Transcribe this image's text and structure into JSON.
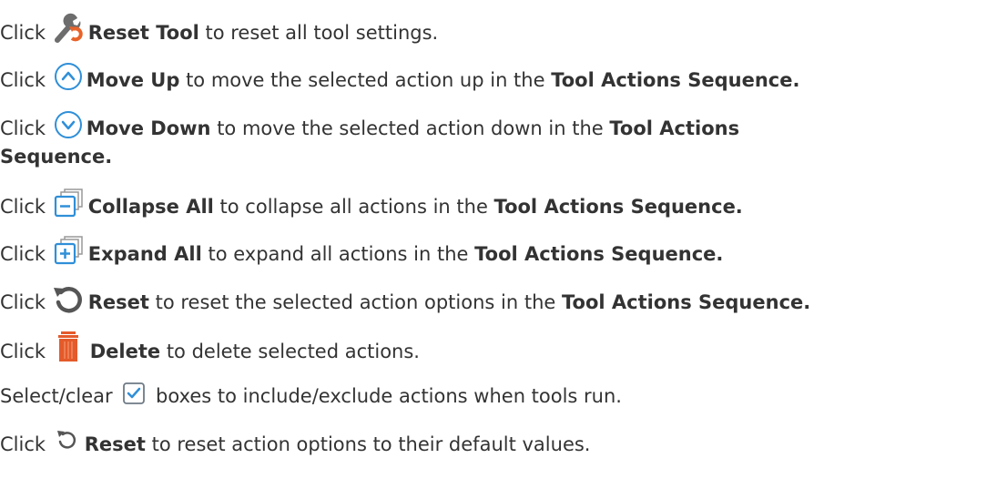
{
  "colors": {
    "text": "#333333",
    "icon_blue": "#2f8fd8",
    "icon_orange": "#e8632a",
    "trash_orange": "#e45a2a",
    "icon_gray": "#555555"
  },
  "lines": [
    {
      "pre": "Click",
      "icon": "wrench-reset-icon",
      "bold": "Reset Tool",
      "post": " to reset all tool settings."
    },
    {
      "pre": "Click",
      "icon": "move-up-icon",
      "bold": "Move Up",
      "post": " to move the selected action up in the ",
      "bold2": "Tool Actions Sequence."
    },
    {
      "pre": "Click",
      "icon": "move-down-icon",
      "bold": "Move Down",
      "post": " to move the selected action down in the ",
      "bold2": "Tool Actions",
      "bold3": "Sequence."
    },
    {
      "pre": "Click",
      "icon": "collapse-all-icon",
      "bold": "Collapse All",
      "post": " to collapse all actions in the ",
      "bold2": "Tool Actions Sequence."
    },
    {
      "pre": "Click",
      "icon": "expand-all-icon",
      "bold": "Expand All",
      "post": " to expand all actions in the ",
      "bold2": "Tool Actions Sequence."
    },
    {
      "pre": "Click",
      "icon": "reset-icon",
      "bold": "Reset",
      "post": " to reset the selected action options in the ",
      "bold2": "Tool Actions Sequence."
    },
    {
      "pre": "Click",
      "icon": "trash-icon",
      "bold": "Delete",
      "post": " to delete selected actions."
    },
    {
      "pre": "Select/clear",
      "icon": "checkbox-icon",
      "post": " boxes to include/exclude actions when tools run."
    },
    {
      "pre": "Click",
      "icon": "reset-small-icon",
      "bold": "Reset",
      "post": " to reset action options to their default values."
    }
  ]
}
